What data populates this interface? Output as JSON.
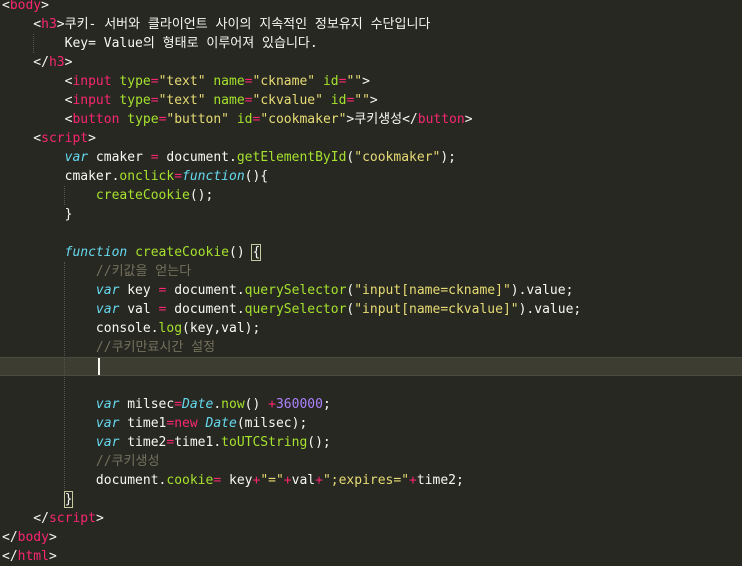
{
  "theme": {
    "background": "#272822",
    "current_line": "#3e3d32",
    "colors": {
      "text": "#f8f8f2",
      "tag": "#f92672",
      "attr": "#a6e22e",
      "string": "#e6db74",
      "keyword": "#66d9ef",
      "number": "#ae81ff",
      "comment": "#75715e"
    }
  },
  "editor": {
    "language": "html",
    "current_line_index": 19,
    "lines": [
      [
        [
          "t",
          "<"
        ],
        [
          "tag",
          "body"
        ],
        [
          "t",
          ">"
        ]
      ],
      [
        [
          "t",
          "    <"
        ],
        [
          "tag",
          "h3"
        ],
        [
          "t",
          ">쿠키- 서버와 클라이언트 사이의 지속적인 정보유지 수단입니다"
        ]
      ],
      [
        [
          "t",
          "        Key= Value의 형태로 이루어져 있습니다."
        ]
      ],
      [
        [
          "t",
          "    </"
        ],
        [
          "tag",
          "h3"
        ],
        [
          "t",
          ">"
        ]
      ],
      [
        [
          "t",
          "        <"
        ],
        [
          "tag",
          "input"
        ],
        [
          "t",
          " "
        ],
        [
          "attr",
          "type"
        ],
        [
          "tag",
          "="
        ],
        [
          "str",
          "\"text\""
        ],
        [
          "t",
          " "
        ],
        [
          "attr",
          "name"
        ],
        [
          "tag",
          "="
        ],
        [
          "str",
          "\"ckname\""
        ],
        [
          "t",
          " "
        ],
        [
          "attr",
          "id"
        ],
        [
          "tag",
          "="
        ],
        [
          "str",
          "\"\""
        ],
        [
          "t",
          ">"
        ]
      ],
      [
        [
          "t",
          "        <"
        ],
        [
          "tag",
          "input"
        ],
        [
          "t",
          " "
        ],
        [
          "attr",
          "type"
        ],
        [
          "tag",
          "="
        ],
        [
          "str",
          "\"text\""
        ],
        [
          "t",
          " "
        ],
        [
          "attr",
          "name"
        ],
        [
          "tag",
          "="
        ],
        [
          "str",
          "\"ckvalue\""
        ],
        [
          "t",
          " "
        ],
        [
          "attr",
          "id"
        ],
        [
          "tag",
          "="
        ],
        [
          "str",
          "\"\""
        ],
        [
          "t",
          ">"
        ]
      ],
      [
        [
          "t",
          "        <"
        ],
        [
          "tag",
          "button"
        ],
        [
          "t",
          " "
        ],
        [
          "attr",
          "type"
        ],
        [
          "tag",
          "="
        ],
        [
          "str",
          "\"button\""
        ],
        [
          "t",
          " "
        ],
        [
          "attr",
          "id"
        ],
        [
          "tag",
          "="
        ],
        [
          "str",
          "\"cookmaker\""
        ],
        [
          "t",
          ">쿠키생성</"
        ],
        [
          "tag",
          "button"
        ],
        [
          "t",
          ">"
        ]
      ],
      [
        [
          "t",
          "    <"
        ],
        [
          "tag",
          "script"
        ],
        [
          "t",
          ">"
        ]
      ],
      [
        [
          "t",
          "        "
        ],
        [
          "kw",
          "var"
        ],
        [
          "t",
          " cmaker "
        ],
        [
          "tag",
          "="
        ],
        [
          "t",
          " document."
        ],
        [
          "fn",
          "getElementById"
        ],
        [
          "t",
          "("
        ],
        [
          "str",
          "\"cookmaker\""
        ],
        [
          "t",
          ");"
        ]
      ],
      [
        [
          "t",
          "        cmaker."
        ],
        [
          "fn",
          "onclick"
        ],
        [
          "tag",
          "="
        ],
        [
          "kw",
          "function"
        ],
        [
          "t",
          "(){"
        ]
      ],
      [
        [
          "t",
          "            "
        ],
        [
          "fn",
          "createCookie"
        ],
        [
          "t",
          "();"
        ]
      ],
      [
        [
          "t",
          "        }"
        ]
      ],
      [
        [
          "t",
          ""
        ]
      ],
      [
        [
          "t",
          "        "
        ],
        [
          "kw",
          "function"
        ],
        [
          "t",
          " "
        ],
        [
          "fn",
          "createCookie"
        ],
        [
          "t",
          "() "
        ],
        [
          "br",
          "{"
        ]
      ],
      [
        [
          "t",
          "            "
        ],
        [
          "cm",
          "//키값을 얻는다"
        ]
      ],
      [
        [
          "t",
          "            "
        ],
        [
          "kw",
          "var"
        ],
        [
          "t",
          " key "
        ],
        [
          "tag",
          "="
        ],
        [
          "t",
          " document."
        ],
        [
          "fn",
          "querySelector"
        ],
        [
          "t",
          "("
        ],
        [
          "str",
          "\"input[name=ckname]\""
        ],
        [
          "t",
          ").value;"
        ]
      ],
      [
        [
          "t",
          "            "
        ],
        [
          "kw",
          "var"
        ],
        [
          "t",
          " val "
        ],
        [
          "tag",
          "="
        ],
        [
          "t",
          " document."
        ],
        [
          "fn",
          "querySelector"
        ],
        [
          "t",
          "("
        ],
        [
          "str",
          "\"input[name=ckvalue]\""
        ],
        [
          "t",
          ").value;"
        ]
      ],
      [
        [
          "t",
          "            console."
        ],
        [
          "fn",
          "log"
        ],
        [
          "t",
          "(key,val);"
        ]
      ],
      [
        [
          "t",
          "            "
        ],
        [
          "cm",
          "//쿠키만료시간 설정"
        ]
      ],
      [
        [
          "t",
          "            "
        ]
      ],
      [
        [
          "t",
          ""
        ]
      ],
      [
        [
          "t",
          "            "
        ],
        [
          "kw",
          "var"
        ],
        [
          "t",
          " milsec"
        ],
        [
          "tag",
          "="
        ],
        [
          "kw",
          "Date"
        ],
        [
          "t",
          "."
        ],
        [
          "fn",
          "now"
        ],
        [
          "t",
          "() "
        ],
        [
          "tag",
          "+"
        ],
        [
          "num",
          "360000"
        ],
        [
          "t",
          ";"
        ]
      ],
      [
        [
          "t",
          "            "
        ],
        [
          "kw",
          "var"
        ],
        [
          "t",
          " time1"
        ],
        [
          "tag",
          "="
        ],
        [
          "tag",
          "new"
        ],
        [
          "t",
          " "
        ],
        [
          "kw",
          "Date"
        ],
        [
          "t",
          "(milsec);"
        ]
      ],
      [
        [
          "t",
          "            "
        ],
        [
          "kw",
          "var"
        ],
        [
          "t",
          " time2"
        ],
        [
          "tag",
          "="
        ],
        [
          "t",
          "time1."
        ],
        [
          "fn",
          "toUTCString"
        ],
        [
          "t",
          "();"
        ]
      ],
      [
        [
          "t",
          "            "
        ],
        [
          "cm",
          "//쿠키생성"
        ]
      ],
      [
        [
          "t",
          "            document."
        ],
        [
          "fn",
          "cookie"
        ],
        [
          "tag",
          "="
        ],
        [
          "t",
          " key"
        ],
        [
          "tag",
          "+"
        ],
        [
          "str",
          "\"=\""
        ],
        [
          "tag",
          "+"
        ],
        [
          "t",
          "val"
        ],
        [
          "tag",
          "+"
        ],
        [
          "str",
          "\";expires=\""
        ],
        [
          "tag",
          "+"
        ],
        [
          "t",
          "time2;"
        ]
      ],
      [
        [
          "t",
          "        "
        ],
        [
          "br",
          "}"
        ]
      ],
      [
        [
          "t",
          "    </"
        ],
        [
          "tag",
          "script"
        ],
        [
          "t",
          ">"
        ]
      ],
      [
        [
          "t",
          "</"
        ],
        [
          "tag",
          "body"
        ],
        [
          "t",
          ">"
        ]
      ],
      [
        [
          "t",
          "</"
        ],
        [
          "tag",
          "html"
        ],
        [
          "t",
          ">"
        ]
      ]
    ]
  }
}
